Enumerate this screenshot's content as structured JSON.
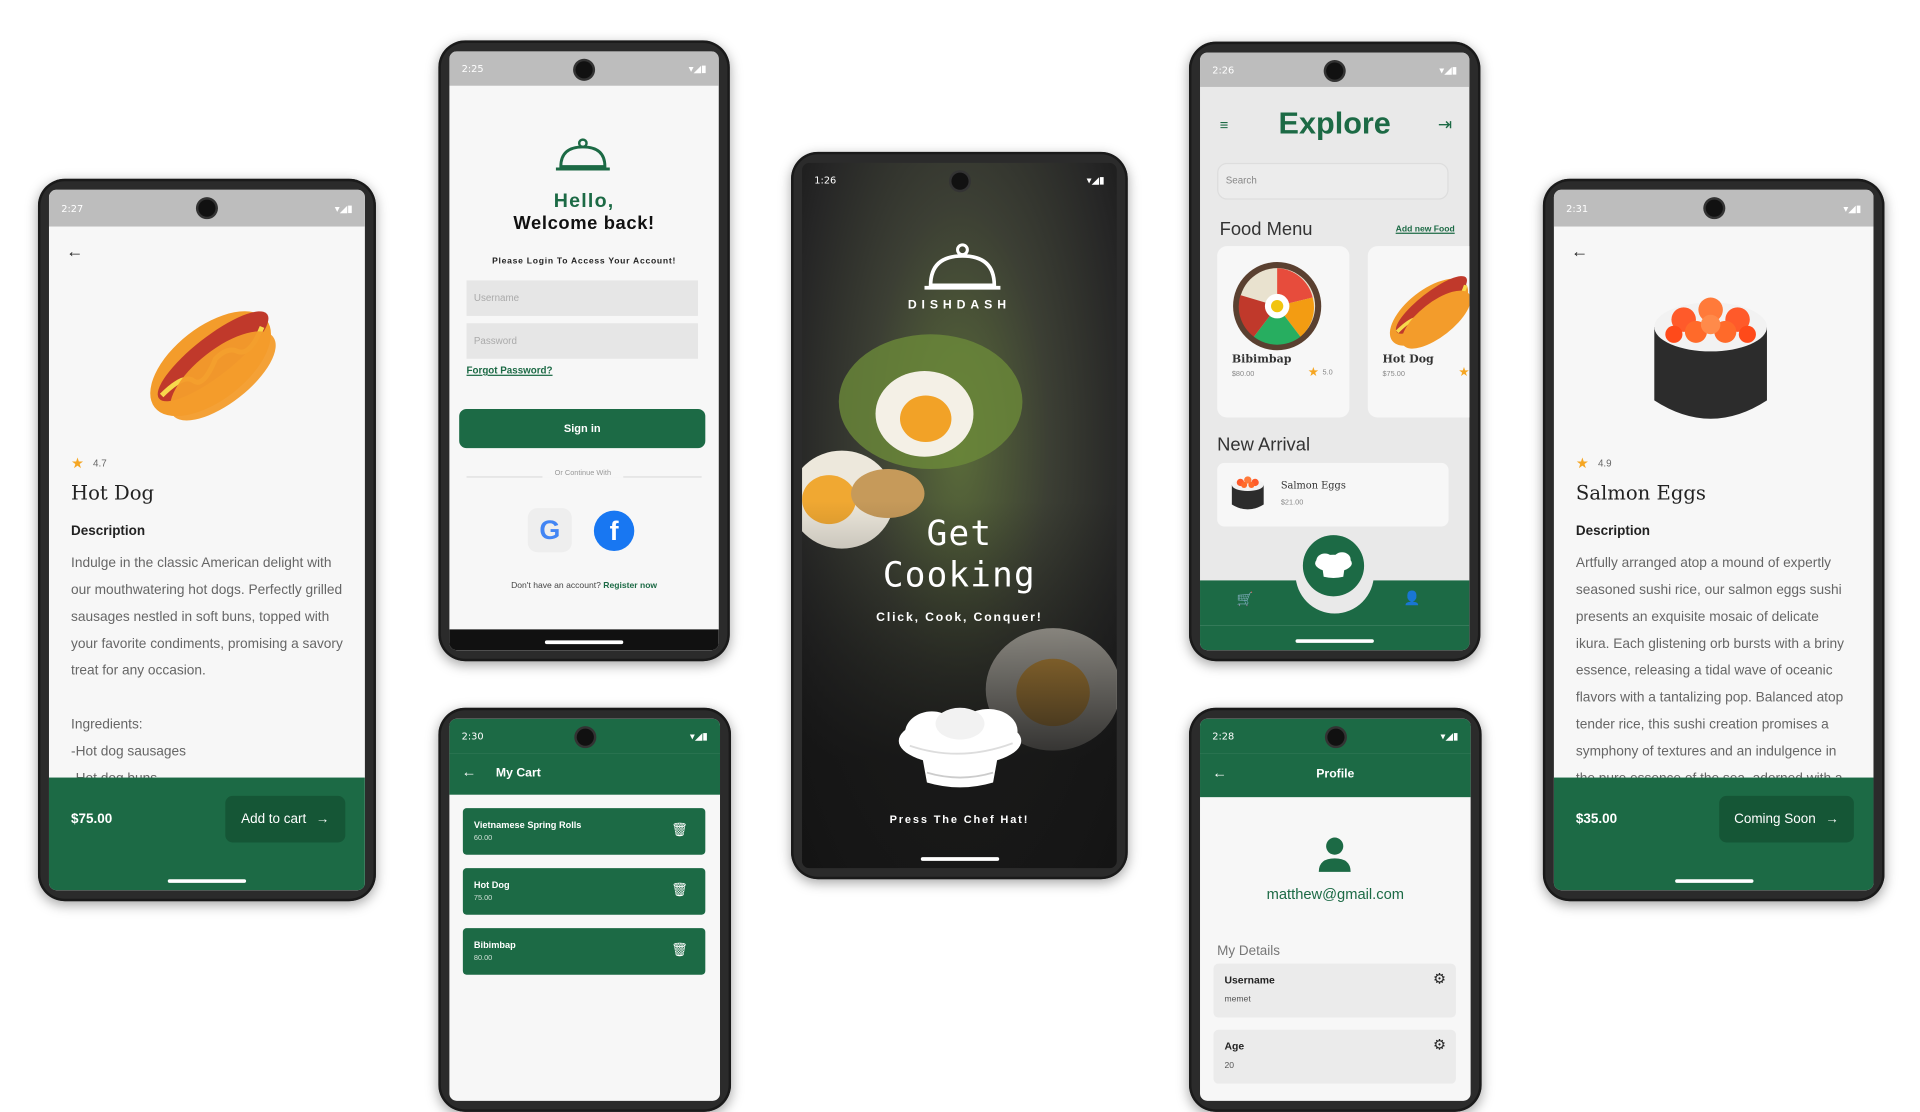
{
  "colors": {
    "primary": "#1c6a45",
    "star": "#f5a623",
    "bg": "#f7f7f7"
  },
  "phone1": {
    "time": "2:27",
    "rating": "4.7",
    "title": "Hot Dog",
    "desc_heading": "Description",
    "desc_lines": [
      "Indulge in the classic American delight with",
      "our mouthwatering hot dogs. Perfectly grilled",
      "sausages nestled in soft buns, topped with",
      "your favorite condiments, promising a savory",
      "treat for any occasion."
    ],
    "ingredients_heading": "Ingredients:",
    "ingredients": [
      "-Hot dog sausages",
      "-Hot dog buns"
    ],
    "price": "$75.00",
    "button": "Add to cart"
  },
  "phone2": {
    "time": "2:25",
    "hello": "Hello,",
    "welcome": "Welcome back!",
    "subtitle": "Please Login To Access Your Account!",
    "username_placeholder": "Username",
    "password_placeholder": "Password",
    "forgot": "Forgot Password?",
    "signin": "Sign in",
    "continue_with": "Or Continue With",
    "no_account": "Don't have an account?",
    "register": "Register now"
  },
  "phone3": {
    "time": "1:26",
    "brand": "DISHDASH",
    "headline1": "Get",
    "headline2": "Cooking",
    "tagline": "Click, Cook, Conquer!",
    "press": "Press The Chef Hat!"
  },
  "phone4": {
    "time": "2:26",
    "title": "Explore",
    "search_placeholder": "Search",
    "food_menu": "Food Menu",
    "add_new": "Add new Food",
    "cards": [
      {
        "name": "Bibimbap",
        "price": "$80.00",
        "rating": "5.0"
      },
      {
        "name": "Hot Dog",
        "price": "$75.00",
        "rating": ""
      }
    ],
    "new_arrival": "New Arrival",
    "arrival": {
      "name": "Salmon Eggs",
      "price": "$21.00"
    }
  },
  "phone5": {
    "time": "2:31",
    "rating": "4.9",
    "title": "Salmon Eggs",
    "desc_heading": "Description",
    "desc_lines": [
      "Artfully arranged atop a mound of expertly",
      "seasoned sushi rice, our salmon eggs sushi",
      "presents an exquisite mosaic of delicate",
      "ikura. Each glistening orb bursts with a briny",
      "essence, releasing a tidal wave of oceanic",
      "flavors with a tantalizing pop. Balanced atop",
      "tender rice, this sushi creation promises a",
      "symphony of textures and an indulgence in",
      "the pure essence of the sea, adorned with a"
    ],
    "price": "$35.00",
    "button": "Coming Soon"
  },
  "phone6": {
    "time": "2:30",
    "title": "My Cart",
    "items": [
      {
        "name": "Vietnamese Spring Rolls",
        "price": "60.00"
      },
      {
        "name": "Hot Dog",
        "price": "75.00"
      },
      {
        "name": "Bibimbap",
        "price": "80.00"
      }
    ]
  },
  "phone7": {
    "time": "2:28",
    "title": "Profile",
    "email": "matthew@gmail.com",
    "section": "My Details",
    "details": [
      {
        "label": "Username",
        "value": "memet"
      },
      {
        "label": "Age",
        "value": "20"
      }
    ]
  }
}
